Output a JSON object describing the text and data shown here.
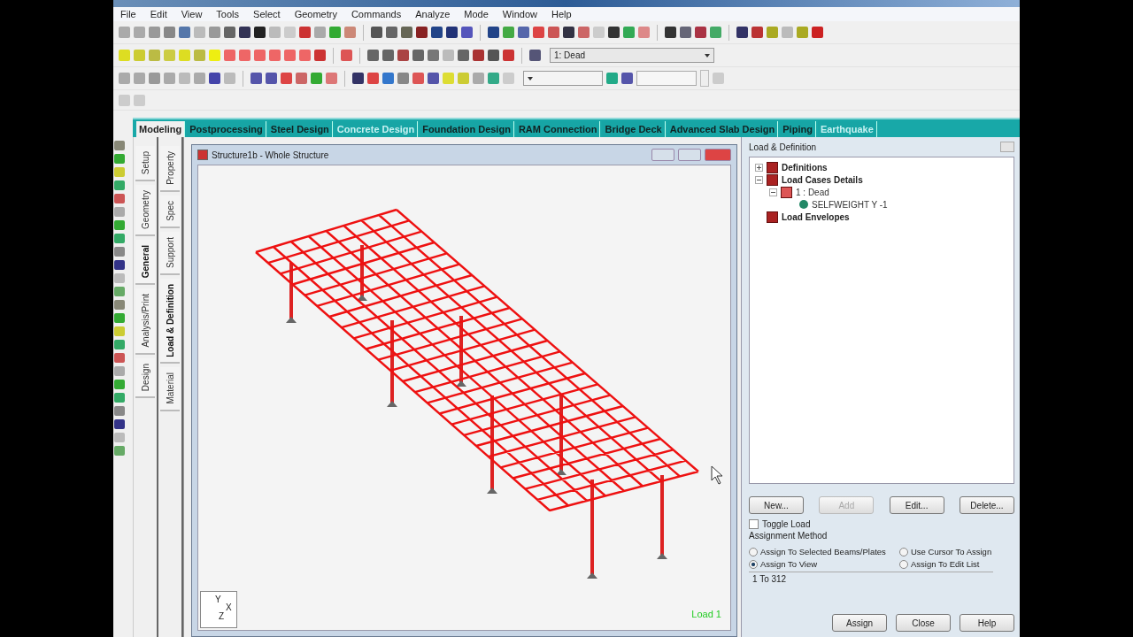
{
  "menu": [
    "File",
    "Edit",
    "View",
    "Tools",
    "Select",
    "Geometry",
    "Commands",
    "Analyze",
    "Mode",
    "Window",
    "Help"
  ],
  "load_case_dropdown": {
    "value": "1: Dead"
  },
  "tabs": [
    {
      "label": "Modeling",
      "selected": true,
      "disabled": false
    },
    {
      "label": "Postprocessing",
      "selected": false,
      "disabled": false
    },
    {
      "label": "Steel Design",
      "selected": false,
      "disabled": false
    },
    {
      "label": "Concrete Design",
      "selected": false,
      "disabled": true
    },
    {
      "label": "Foundation Design",
      "selected": false,
      "disabled": false
    },
    {
      "label": "RAM Connection",
      "selected": false,
      "disabled": false
    },
    {
      "label": "Bridge Deck",
      "selected": false,
      "disabled": false
    },
    {
      "label": "Advanced Slab Design",
      "selected": false,
      "disabled": false
    },
    {
      "label": "Piping",
      "selected": false,
      "disabled": false
    },
    {
      "label": "Earthquake",
      "selected": false,
      "disabled": true
    }
  ],
  "side_tabs": [
    {
      "label": "Setup",
      "selected": false
    },
    {
      "label": "Geometry",
      "selected": false
    },
    {
      "label": "General",
      "selected": true
    },
    {
      "label": "Analysis/Print",
      "selected": false
    },
    {
      "label": "Design",
      "selected": false
    }
  ],
  "page_tabs": [
    {
      "label": "Property",
      "selected": false
    },
    {
      "label": "Spec",
      "selected": false
    },
    {
      "label": "Support",
      "selected": false
    },
    {
      "label": "Load & Definition",
      "selected": true
    },
    {
      "label": "Material",
      "selected": false
    }
  ],
  "structure_window": {
    "title": "Structure1b - Whole Structure",
    "axes": [
      "Y",
      "X",
      "Z"
    ],
    "load_label": "Load 1"
  },
  "panel": {
    "title": "Load & Definition",
    "tree": [
      {
        "label": "Definitions",
        "expanded": false
      },
      {
        "label": "Load Cases Details",
        "expanded": true,
        "children": [
          {
            "label": "1 : Dead",
            "expanded": true,
            "children": [
              {
                "label": "SELFWEIGHT Y -1"
              }
            ]
          }
        ]
      },
      {
        "label": "Load Envelopes"
      }
    ],
    "buttons": [
      {
        "label": "New...",
        "disabled": false
      },
      {
        "label": "Add",
        "disabled": true
      },
      {
        "label": "Edit...",
        "disabled": false
      },
      {
        "label": "Delete...",
        "disabled": false
      }
    ],
    "toggle_load": {
      "label": "Toggle Load",
      "checked": false
    },
    "assignment_method": "Assignment Method",
    "options": [
      {
        "label": "Assign To Selected Beams/Plates",
        "selected": false
      },
      {
        "label": "Use Cursor To Assign",
        "selected": false
      },
      {
        "label": "Assign To View",
        "selected": true
      },
      {
        "label": "Assign To Edit List",
        "selected": false
      }
    ],
    "list_value": "1 To 312",
    "footer_buttons": [
      "Assign",
      "Close",
      "Help"
    ]
  }
}
